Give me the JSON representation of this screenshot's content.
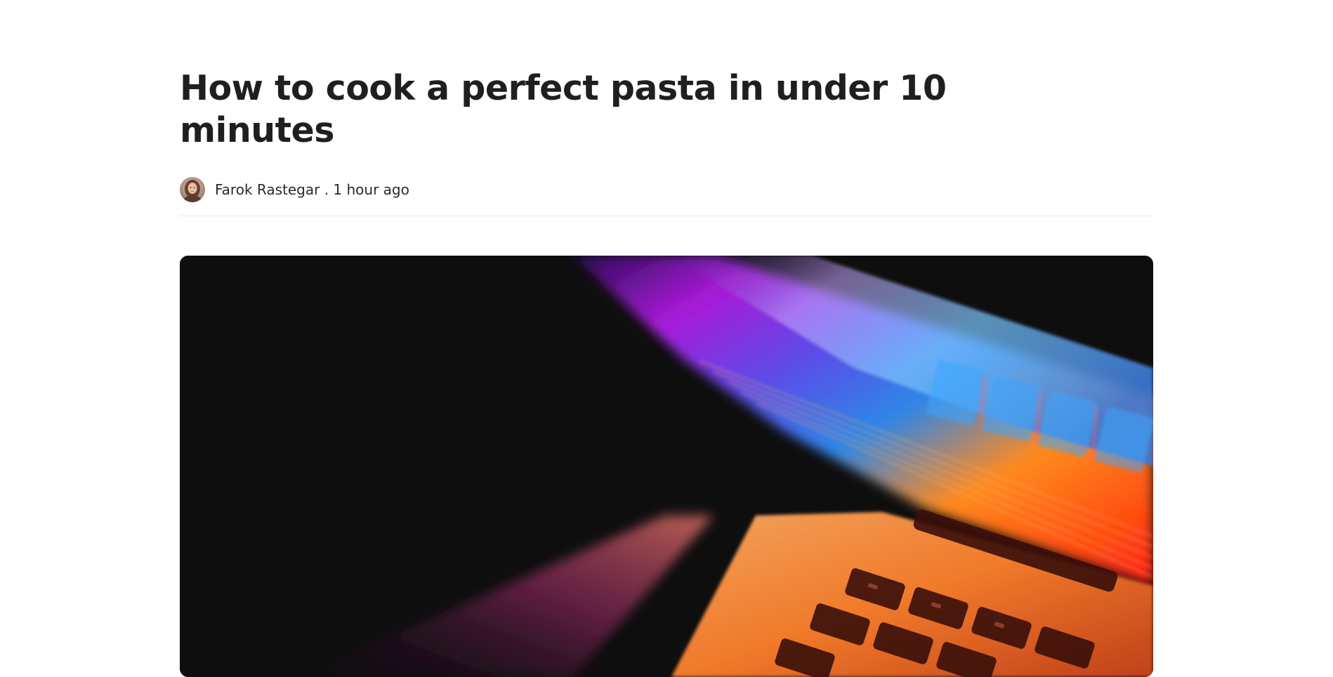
{
  "article": {
    "title": "How to cook a perfect pasta in under 10 minutes",
    "author": "Farok Rastegar",
    "separator": " . ",
    "time_ago": "1 hour ago"
  },
  "avatar": {
    "icon": "author-avatar-photo"
  },
  "hero_image": {
    "icon": "laptop-keyboard-neon-photo"
  },
  "colors": {
    "background": "#ffffff",
    "title": "#1f1f1f",
    "meta_text": "#2a2a2a",
    "divider": "#e8e8e8",
    "hero_background": "#0e0e0e"
  }
}
